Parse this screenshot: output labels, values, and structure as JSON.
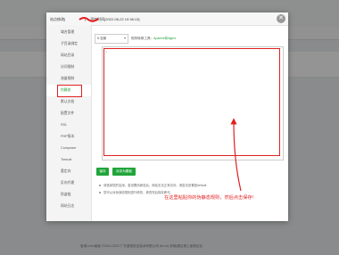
{
  "background": {
    "page_title": "",
    "toolbar_buttons": [],
    "footer": "宝塔Linux面板 ©2014-2022 广东堡塔安全技术有限公司 (bt.cn)  求助|建议请上宝塔论坛"
  },
  "modal": {
    "title": "站点修改[",
    "title_suffix": "] -- 添加时间[2022-06-22 10:36:13]",
    "close_icon": "✕",
    "sidebar": {
      "items": [
        {
          "label": "域名管理",
          "active": false
        },
        {
          "label": "子目录绑定",
          "active": false
        },
        {
          "label": "网站目录",
          "active": false
        },
        {
          "label": "访问限制",
          "active": false
        },
        {
          "label": "流量限制",
          "active": false
        },
        {
          "label": "伪静态",
          "active": true
        },
        {
          "label": "默认文档",
          "active": false
        },
        {
          "label": "配置文件",
          "active": false
        },
        {
          "label": "SSL",
          "active": false
        },
        {
          "label": "PHP版本",
          "active": false
        },
        {
          "label": "Composer",
          "active": false
        },
        {
          "label": "Tomcat",
          "active": false
        },
        {
          "label": "重定向",
          "active": false
        },
        {
          "label": "反向代理",
          "active": false
        },
        {
          "label": "防盗链",
          "active": false
        },
        {
          "label": "网站日志",
          "active": false
        }
      ]
    },
    "rewrite": {
      "template_select_value": "0.当前",
      "hint_prefix": "规则转换工具：",
      "hint_link": "Apache转Nginx",
      "line_number": "1",
      "editor_content": ""
    },
    "buttons": {
      "save": "保存",
      "save_as_template": "另存为模板"
    },
    "tips": [
      "请选择您的应用，若设置伪静态后，网站无法正常访问，请尝试设置回default",
      "您可以对伪静态规则进行修改，修改完后保存即可。"
    ]
  },
  "annotation": {
    "text": "在这里粘贴你的伪静态规则，然后点击保存!",
    "color": "#e02020"
  },
  "colors": {
    "accent": "#20a53a",
    "highlight": "#e02020"
  }
}
